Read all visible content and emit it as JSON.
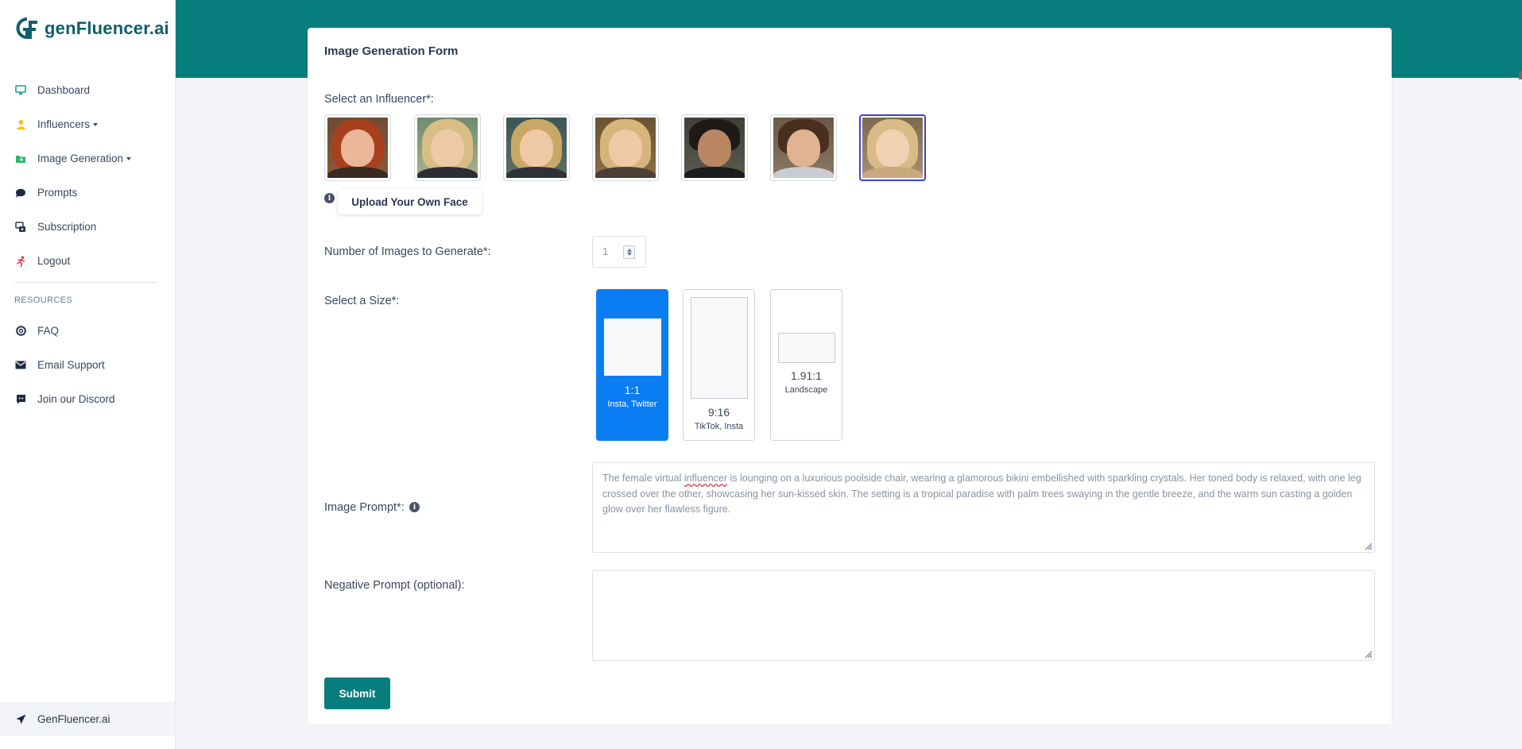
{
  "brand": {
    "name": "genFluencer.ai",
    "color": "#0e5f6b"
  },
  "sidebar": {
    "items": [
      {
        "label": "Dashboard",
        "icon": "monitor-icon"
      },
      {
        "label": "Influencers",
        "icon": "user-icon",
        "dropdown": true
      },
      {
        "label": "Image Generation",
        "icon": "image-folder-icon",
        "dropdown": true
      },
      {
        "label": "Prompts",
        "icon": "chat-bubble-icon"
      },
      {
        "label": "Subscription",
        "icon": "subscription-icon"
      },
      {
        "label": "Logout",
        "icon": "running-person-icon"
      }
    ],
    "resources_title": "RESOURCES",
    "resources": [
      {
        "label": "FAQ",
        "icon": "lifebuoy-icon"
      },
      {
        "label": "Email Support",
        "icon": "envelope-icon"
      },
      {
        "label": "Join our Discord",
        "icon": "discord-icon"
      }
    ],
    "footer": {
      "label": "GenFluencer.ai",
      "icon": "paper-plane-icon"
    }
  },
  "colors": {
    "accent": "#087d7d",
    "selected_size": "#0a7df3",
    "selected_influencer_border": "#3d3fd6"
  },
  "form": {
    "title": "Image Generation Form",
    "influencer_label": "Select an Influencer*:",
    "influencers_selected_index": 6,
    "upload_label": "Upload Your Own Face",
    "count_label": "Number of Images to Generate*:",
    "count_value": "1",
    "size_label": "Select a Size*:",
    "sizes": [
      {
        "ratio": "1:1",
        "desc": "Insta, Twitter",
        "selected": true
      },
      {
        "ratio": "9:16",
        "desc": "TikTok, Insta",
        "selected": false
      },
      {
        "ratio": "1.91:1",
        "desc": "Landscape",
        "selected": false
      }
    ],
    "prompt_label": "Image Prompt*:",
    "prompt_before": "The female virtual ",
    "prompt_flagged_word": "influencer",
    "prompt_after": " is lounging on a luxurious poolside chair, wearing a glamorous bikini embellished with sparkling crystals. Her toned body is relaxed, with one leg crossed over the other, showcasing her sun-kissed skin. The setting is a tropical paradise with palm trees swaying in the gentle breeze, and the warm sun casting a golden glow over her flawless figure.",
    "negative_label": "Negative Prompt (optional):",
    "negative_value": "",
    "submit_label": "Submit"
  }
}
